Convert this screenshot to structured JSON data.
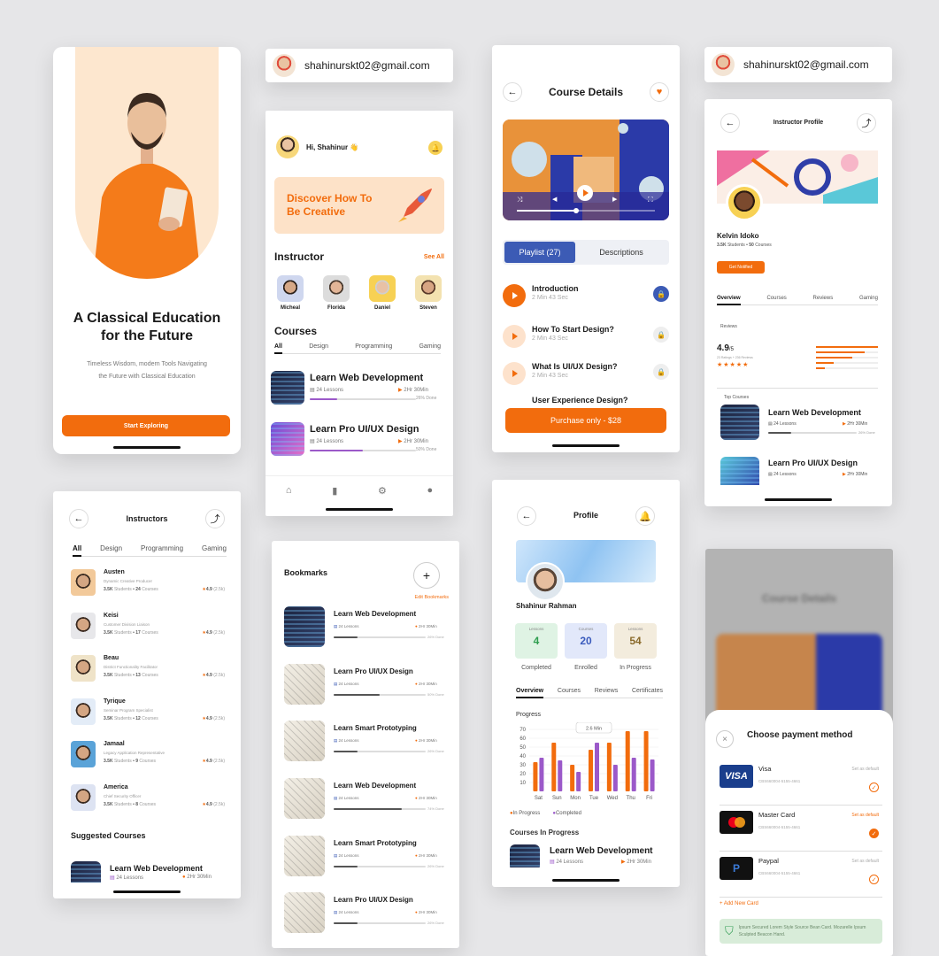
{
  "onboarding": {
    "title": "A Classical Education for the Future",
    "subtitle": "Timeless Wisdom, modern Tools Navigating the Future with Classical Education",
    "cta": "Start Exploring"
  },
  "email_badges": [
    "shahinurskt02@gmail.com",
    "shahinurskt02@gmail.com"
  ],
  "home": {
    "greeting": "Hi, Shahinur 👋",
    "banner": "Discover How To Be Creative",
    "instructor_heading": "Instructor",
    "see_all": "See All",
    "instructors": [
      "Micheal",
      "Florida",
      "Daniel",
      "Steven"
    ],
    "courses_heading": "Courses",
    "filters": [
      "All",
      "Design",
      "Programming",
      "Gaming"
    ],
    "courses": [
      {
        "title": "Learn Web Development",
        "lessons": "24 Lessons",
        "duration": "2Hr 30Min",
        "done": "26% Done",
        "progress": 0.26
      },
      {
        "title": "Learn Pro UI/UX Design",
        "lessons": "24 Lessons",
        "duration": "2Hr 30Min",
        "done": "50% Done",
        "progress": 0.5
      }
    ]
  },
  "course_details": {
    "title": "Course Details",
    "tabs": [
      "Playlist (27)",
      "Descriptions"
    ],
    "lessons": [
      {
        "title": "Introduction",
        "meta": "2 Min 43 Sec"
      },
      {
        "title": "How To Start Design?",
        "meta": "2 Min 43 Sec"
      },
      {
        "title": "What Is UI/UX Design?",
        "meta": "2 Min 43 Sec"
      },
      {
        "title": "User Experience Design?",
        "meta": ""
      }
    ],
    "purchase": "Purchase only - $28"
  },
  "instructor_profile": {
    "title": "Instructor Profile",
    "name": "Kelvin Idoko",
    "stats_students": "3.5K",
    "stats_students_label": "Students",
    "stats_courses": "50",
    "stats_courses_label": "Courses",
    "get_notified": "Get Notified",
    "tabs": [
      "Overview",
      "Courses",
      "Reviews",
      "Gaming"
    ],
    "reviews_label": "Reviews",
    "rating": "4.9",
    "rating_max": "/5",
    "rating_note": "23 Ratings + 236 Reviews",
    "top_courses": "Top Courses",
    "courses": [
      {
        "title": "Learn Web Development",
        "lessons": "24 Lessons",
        "duration": "2Hr 30Min",
        "done": "26% Done"
      },
      {
        "title": "Learn Pro UI/UX Design",
        "lessons": "24 Lessons",
        "duration": "2Hr 30Min"
      }
    ]
  },
  "instructors_page": {
    "title": "Instructors",
    "filters": [
      "All",
      "Design",
      "Programming",
      "Gaming"
    ],
    "list": [
      {
        "name": "Austen",
        "role": "Dynamic Creative Producer",
        "students": "3.5K",
        "courses": "24",
        "rating": "4.9",
        "reviews": "(2.5k)"
      },
      {
        "name": "Keisi",
        "role": "Customer Division Liaison",
        "students": "3.5K",
        "courses": "17",
        "rating": "4.9",
        "reviews": "(2.5k)"
      },
      {
        "name": "Beau",
        "role": "District Functionality Facilitator",
        "students": "3.5K",
        "courses": "13",
        "rating": "4.9",
        "reviews": "(2.5k)"
      },
      {
        "name": "Tyrique",
        "role": "Seminar Program Specialist",
        "students": "3.5K",
        "courses": "12",
        "rating": "4.9",
        "reviews": "(2.5k)"
      },
      {
        "name": "Jamaal",
        "role": "Legacy Application Representative",
        "students": "3.5K",
        "courses": "9",
        "rating": "4.9",
        "reviews": "(2.5k)"
      },
      {
        "name": "America",
        "role": "Chief Security Officer",
        "students": "3.5K",
        "courses": "8",
        "rating": "4.9",
        "reviews": "(2.5k)"
      }
    ],
    "students_label": "Students",
    "courses_label": "Courses",
    "suggested": "Suggested Courses",
    "suggested_course": {
      "title": "Learn Web Development",
      "lessons": "24 Lessons",
      "duration": "2Hr 30Min"
    }
  },
  "bookmarks": {
    "title": "Bookmarks",
    "edit": "Edit Bookmarks",
    "items": [
      {
        "title": "Learn Web Development",
        "lessons": "24 Lessons",
        "duration": "2Hr 30Min",
        "done": "26% Done",
        "progress": 0.26
      },
      {
        "title": "Learn Pro UI/UX Design",
        "lessons": "24 Lessons",
        "duration": "2Hr 30Min",
        "done": "50% Done",
        "progress": 0.5
      },
      {
        "title": "Learn Smart Prototyping",
        "lessons": "24 Lessons",
        "duration": "2Hr 30Min",
        "done": "26% Done",
        "progress": 0.26
      },
      {
        "title": "Learn Web Development",
        "lessons": "24 Lessons",
        "duration": "2Hr 30Min",
        "done": "74% Done",
        "progress": 0.74
      },
      {
        "title": "Learn Smart Prototyping",
        "lessons": "24 Lessons",
        "duration": "2Hr 30Min",
        "done": "26% Done",
        "progress": 0.26
      },
      {
        "title": "Learn Pro UI/UX Design",
        "lessons": "24 Lessons",
        "duration": "2Hr 30Min",
        "done": "26% Done",
        "progress": 0.26
      }
    ]
  },
  "profile": {
    "title": "Profile",
    "name": "Shahinur Rahman",
    "stats": [
      {
        "label": "Lessons",
        "value": "4",
        "caption": "Completed",
        "color": "#2e9e4f",
        "bg": "#dff3e4"
      },
      {
        "label": "Courses",
        "value": "20",
        "caption": "Enrolled",
        "color": "#3a5bbd",
        "bg": "#e2e8fa"
      },
      {
        "label": "Lessons",
        "value": "54",
        "caption": "In Progress",
        "color": "#8a6a2a",
        "bg": "#f3ecdd"
      }
    ],
    "tabs": [
      "Overview",
      "Courses",
      "Reviews",
      "Certificates"
    ],
    "progress_label": "Progress",
    "tooltip": "2.6 Min",
    "legend": [
      "In Progress",
      "Completed"
    ],
    "courses_in_progress": "Courses In Progress",
    "course": {
      "title": "Learn Web Development",
      "lessons": "24 Lessons",
      "duration": "2Hr 30Min"
    }
  },
  "chart_data": {
    "type": "bar",
    "categories": [
      "Sat",
      "Sun",
      "Mon",
      "Tue",
      "Wed",
      "Thu",
      "Fri"
    ],
    "series": [
      {
        "name": "In Progress",
        "values": [
          33,
          55,
          30,
          47,
          55,
          68,
          68
        ]
      },
      {
        "name": "Completed",
        "values": [
          38,
          35,
          22,
          55,
          30,
          38,
          36
        ]
      }
    ],
    "ylim": [
      0,
      70
    ],
    "yticks": [
      "70",
      "60",
      "50",
      "40",
      "30",
      "20",
      "10"
    ],
    "colors": {
      "In Progress": "#f26c0d",
      "Completed": "#9b59c9"
    }
  },
  "payment": {
    "blurred_title": "Course Details",
    "title": "Choose payment method",
    "methods": [
      {
        "name": "Visa",
        "number": "CBS660004-5155-4661",
        "action": "Set as default",
        "selected": false
      },
      {
        "name": "Master Card",
        "number": "CBS660004-5155-4661",
        "action": "Set as default",
        "selected": true
      },
      {
        "name": "Paypal",
        "number": "CBS660004-5155-4661",
        "action": "Set as default",
        "selected": false
      }
    ],
    "add": "+ Add New Card",
    "notice": "Ipsum Secured Lorem Style Source Bean Card. Mozarelle Ipsum Sculpted Beacon Hand."
  }
}
